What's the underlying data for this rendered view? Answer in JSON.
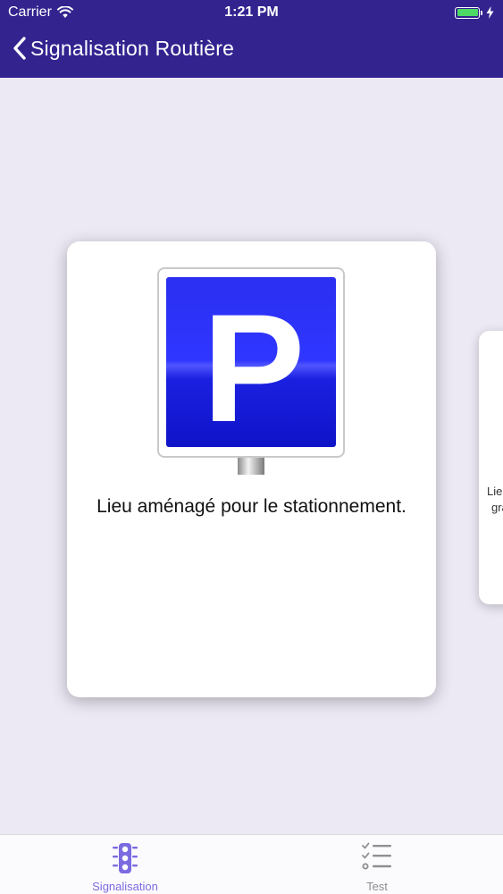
{
  "status_bar": {
    "carrier": "Carrier",
    "time": "1:21 PM"
  },
  "nav": {
    "title": "Signalisation Routière"
  },
  "card": {
    "sign_letter": "P",
    "description": "Lieu aménagé pour le stationnement."
  },
  "next_card": {
    "line1": "Lie",
    "line2": "gra"
  },
  "tabs": [
    {
      "label": "Signalisation",
      "icon": "traffic-light-icon",
      "active": true
    },
    {
      "label": "Test",
      "icon": "checklist-icon",
      "active": false
    }
  ],
  "colors": {
    "nav_background": "#33238f",
    "screen_background": "#ece8f4",
    "active_tab": "#7b6be0",
    "inactive_tab": "#8e8e93",
    "sign_blue": "#2a2ff0",
    "battery": "#4cd964"
  }
}
